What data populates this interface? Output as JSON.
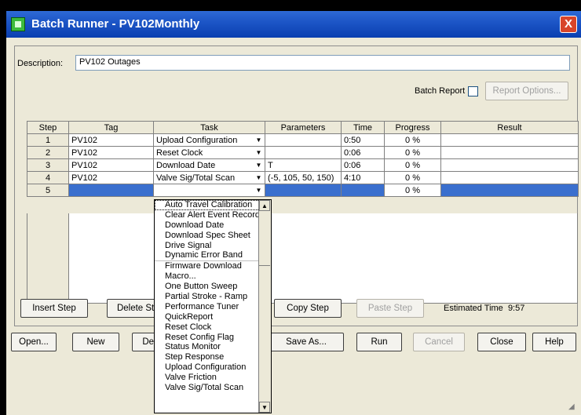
{
  "window": {
    "title": "Batch Runner - PV102Monthly",
    "close_label": "X"
  },
  "description": {
    "label": "Description:",
    "value": "PV102 Outages"
  },
  "batch_report": {
    "label": "Batch Report",
    "options_label": "Report Options..."
  },
  "columns": [
    "Step",
    "Tag",
    "Task",
    "Parameters",
    "Time",
    "Progress",
    "Result"
  ],
  "rows": [
    {
      "step": "1",
      "tag": "PV102",
      "task": "Upload Configuration",
      "parameters": "",
      "time": "0:50",
      "progress": "0 %",
      "result": ""
    },
    {
      "step": "2",
      "tag": "PV102",
      "task": "Reset Clock",
      "parameters": "",
      "time": "0:06",
      "progress": "0 %",
      "result": ""
    },
    {
      "step": "3",
      "tag": "PV102",
      "task": "Download Date",
      "parameters": "T",
      "time": "0:06",
      "progress": "0 %",
      "result": ""
    },
    {
      "step": "4",
      "tag": "PV102",
      "task": "Valve Sig/Total Scan",
      "parameters": "(-5, 105, 50, 150)",
      "time": "4:10",
      "progress": "0 %",
      "result": ""
    },
    {
      "step": "5",
      "tag": "",
      "task": "",
      "parameters": "",
      "time": "",
      "progress": "0 %",
      "result": ""
    }
  ],
  "task_options": [
    "Auto Travel Calibration",
    "Clear Alert Event Record",
    "Download Date",
    "Download Spec Sheet",
    "Drive Signal",
    "Dynamic Error Band",
    "Firmware Download",
    "Macro...",
    "One Button Sweep",
    "Partial Stroke - Ramp",
    "Performance Tuner",
    "QuickReport",
    "Reset Clock",
    "Reset Config Flag",
    "Status Monitor",
    "Step Response",
    "Upload Configuration",
    "Valve Friction",
    "Valve Sig/Total Scan"
  ],
  "step_buttons": {
    "insert": "Insert Step",
    "delete": "Delete Step",
    "copy": "Copy Step",
    "paste": "Paste Step"
  },
  "estimated_time": {
    "label": "Estimated Time",
    "value": "9:57"
  },
  "bottom_buttons": {
    "open": "Open...",
    "new": "New",
    "delete": "Delete",
    "save_as": "Save As...",
    "run": "Run",
    "cancel": "Cancel",
    "close": "Close",
    "help": "Help"
  }
}
